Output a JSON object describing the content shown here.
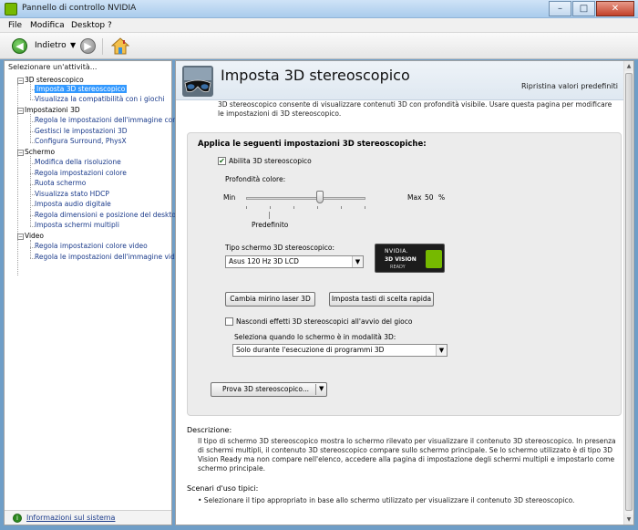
{
  "window": {
    "title": "Pannello di controllo NVIDIA",
    "controls": [
      "–",
      "□",
      "✕"
    ]
  },
  "menu": [
    "File",
    "Modifica",
    "Desktop",
    "?"
  ],
  "toolbar": {
    "back_label": "Indietro",
    "dropdown_arrow": "▼",
    "back_glyph": "◀",
    "fwd_glyph": "▶"
  },
  "sidebar": {
    "header": "Selezionare un'attività...",
    "categories": [
      {
        "label": "3D stereoscopico",
        "items": [
          "Imposta 3D stereoscopico",
          "Visualizza la compatibilità con i giochi"
        ]
      },
      {
        "label": "Impostazioni 3D",
        "items": [
          "Regola le impostazioni dell'immagine con an",
          "Gestisci le impostazioni 3D",
          "Configura Surround, PhysX"
        ]
      },
      {
        "label": "Schermo",
        "items": [
          "Modifica della risoluzione",
          "Regola impostazioni colore",
          "Ruota schermo",
          "Visualizza stato HDCP",
          "Imposta audio digitale",
          "Regola dimensioni e posizione del desktop",
          "Imposta schermi multipli"
        ]
      },
      {
        "label": "Video",
        "items": [
          "Regola impostazioni colore video",
          "Regola le impostazioni dell'immagine video"
        ]
      }
    ],
    "toggle": "−",
    "footer_link": "Informazioni sul sistema"
  },
  "page": {
    "title": "Imposta 3D stereoscopico",
    "restore": "Ripristina valori predefiniti",
    "intro": "3D stereoscopico consente di visualizzare contenuti 3D con profondità visibile. Usare questa pagina per modificare le impostazioni di 3D stereoscopico.",
    "group_title": "Applica le seguenti impostazioni 3D stereoscopiche:",
    "enable_label": "Abilita 3D stereoscopico",
    "enable_checked": true,
    "depth_label": "Profondità colore:",
    "min_label": "Min",
    "max_label": "Max",
    "depth_value": "50",
    "depth_unit": "%",
    "depth_fraction": 0.5,
    "default_label": "Predefinito",
    "monitor_type_label": "Tipo schermo 3D stereoscopico:",
    "monitor_type_value": "Asus 120 Hz 3D LCD",
    "logo": {
      "line1": "NVIDIA.",
      "line2": "3D VISION",
      "line3": "READY"
    },
    "btn_laser": "Cambia mirino laser 3D",
    "btn_hotkeys": "Imposta tasti di scelta rapida",
    "hide_effects_label": "Nascondi effetti 3D stereoscopici all'avvio del gioco",
    "when_label": "Seleziona quando lo schermo è in modalità 3D:",
    "when_value": "Solo durante l'esecuzione di programmi 3D",
    "test_btn": "Prova 3D stereoscopico...",
    "description_label": "Descrizione:",
    "description_text": "Il tipo di schermo 3D stereoscopico mostra lo schermo rilevato per visualizzare il contenuto 3D stereoscopico. In presenza di schermi multipli, il contenuto 3D stereoscopico compare sullo schermo principale. Se lo schermo utilizzato è di tipo 3D Vision Ready ma non compare nell'elenco, accedere alla pagina di impostazione degli schermi multipli e impostarlo come schermo principale.",
    "scenarios_label": "Scenari d'uso tipici:",
    "scenario_1": "• Selezionare il tipo appropriato in base allo schermo utilizzato per visualizzare il contenuto 3D stereoscopico."
  },
  "colors": {
    "accent_green": "#76b900",
    "selection_blue": "#3399ff",
    "link_blue": "#1a3a8a"
  }
}
